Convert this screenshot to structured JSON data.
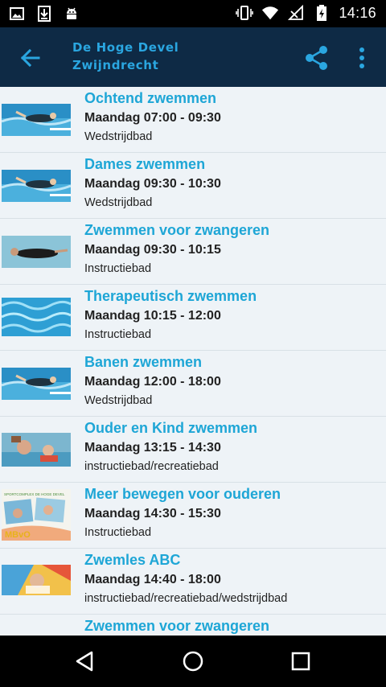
{
  "status_bar": {
    "time": "14:16",
    "left_icons": [
      "image-icon",
      "download-icon",
      "android-icon"
    ],
    "right_icons": [
      "vibrate-icon",
      "wifi-icon",
      "no-signal-icon",
      "battery-charging-icon"
    ]
  },
  "app_bar": {
    "title_line1": "De Hoge Devel",
    "title_line2": "Zwijndrecht",
    "accent": "#2aa6e0",
    "background": "#0e2a45"
  },
  "items": [
    {
      "title": "Ochtend zwemmen",
      "time": "Maandag 07:00 - 09:30",
      "place": "Wedstrijdbad",
      "thumb": "swimmer"
    },
    {
      "title": "Dames zwemmen",
      "time": "Maandag 09:30 - 10:30",
      "place": "Wedstrijdbad",
      "thumb": "swimmer"
    },
    {
      "title": "Zwemmen voor zwangeren",
      "time": "Maandag 09:30 - 10:15",
      "place": "Instructiebad",
      "thumb": "floating"
    },
    {
      "title": "Therapeutisch zwemmen",
      "time": "Maandag 10:15 - 12:00",
      "place": "Instructiebad",
      "thumb": "water"
    },
    {
      "title": "Banen zwemmen",
      "time": "Maandag 12:00 - 18:00",
      "place": "Wedstrijdbad",
      "thumb": "swimmer"
    },
    {
      "title": "Ouder en Kind zwemmen",
      "time": "Maandag 13:15 - 14:30",
      "place": "instructiebad/recreatiebad",
      "thumb": "family"
    },
    {
      "title": "Meer bewegen voor ouderen",
      "time": "Maandag 14:30 - 15:30",
      "place": "Instructiebad",
      "thumb": "mbvo"
    },
    {
      "title": "Zwemles ABC",
      "time": "Maandag 14:40 - 18:00",
      "place": "instructiebad/recreatiebad/wedstrijdbad",
      "thumb": "kid"
    },
    {
      "title": "Zwemmen voor zwangeren",
      "time": "",
      "place": "",
      "thumb": "floating"
    }
  ],
  "mbvo_thumb_text": "SPORTCOMPLEX DE HOGE DEVEL",
  "mbvo_logo_text": "MBvO",
  "nav": {
    "back": "back-triangle-icon",
    "home": "home-circle-icon",
    "recents": "recents-square-icon"
  }
}
